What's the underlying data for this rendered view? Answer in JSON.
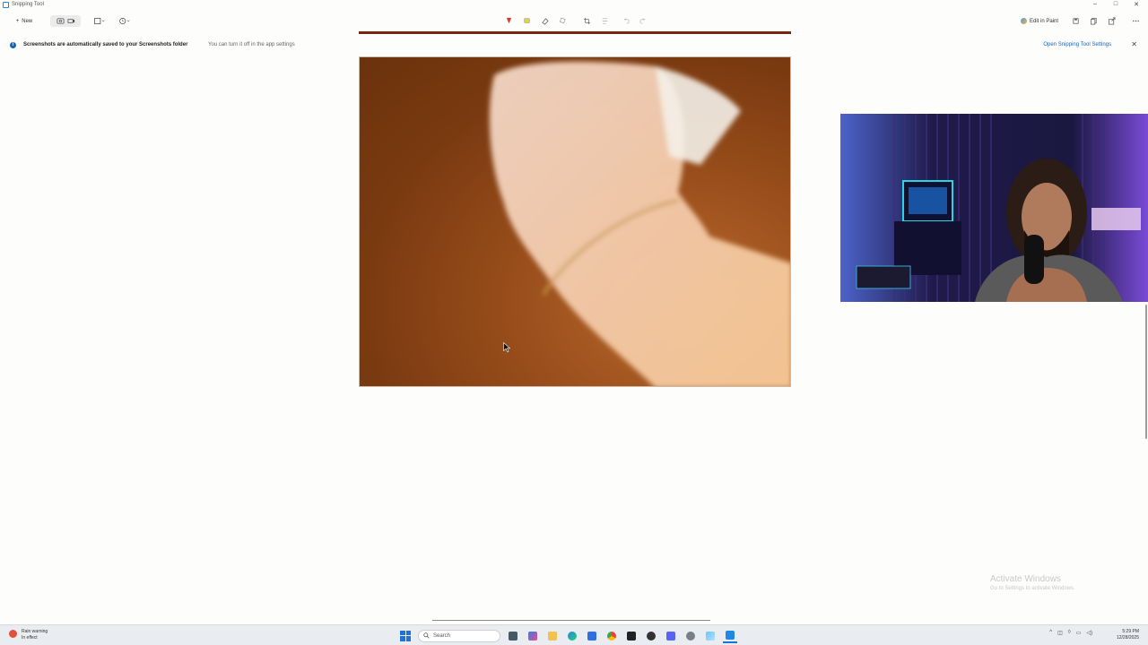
{
  "window": {
    "title": "Snipping Tool",
    "controls": [
      "minimize",
      "maximize",
      "close"
    ]
  },
  "toolbar": {
    "new_label": "New",
    "right_actions": [
      "Edit in Paint"
    ]
  },
  "infobar": {
    "message": "Screenshots are automatically saved to your Screenshots folder",
    "submessage": "You can turn it off in the app settings",
    "link": "Open Snipping Tool Settings"
  },
  "watermark": {
    "line1": "Activate Windows",
    "line2": "Go to Settings to activate Windows."
  },
  "taskbar": {
    "weather_line1": "Rain warning",
    "weather_line2": "In effect",
    "search_placeholder": "Search",
    "time": "5:29 PM",
    "date": "12/28/2025",
    "accent": "#1e74d6"
  }
}
